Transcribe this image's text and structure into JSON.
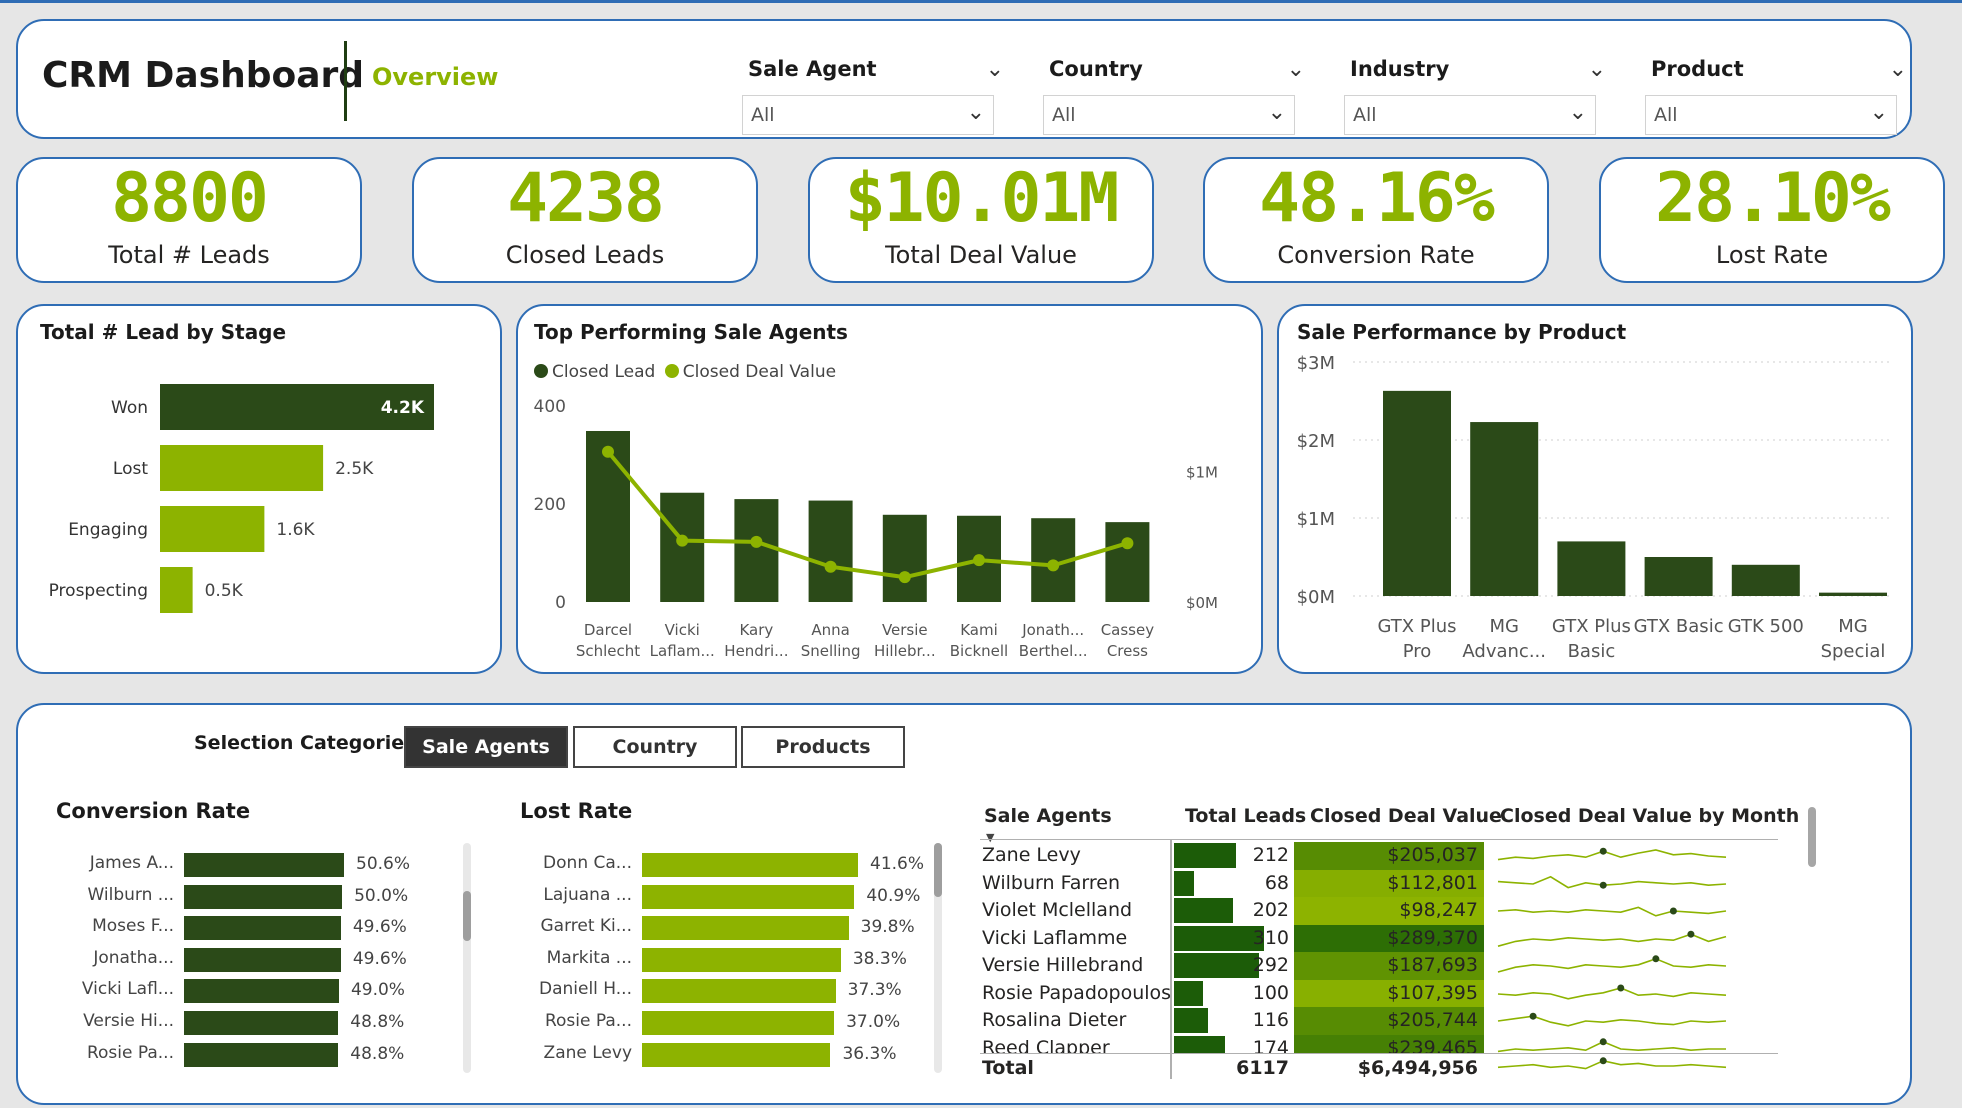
{
  "header": {
    "title": "CRM Dashboard",
    "subtitle": "Overview",
    "slicers": [
      {
        "label": "Sale Agent",
        "value": "All"
      },
      {
        "label": "Country",
        "value": "All"
      },
      {
        "label": "Industry",
        "value": "All"
      },
      {
        "label": "Product",
        "value": "All"
      }
    ]
  },
  "kpis": [
    {
      "value": "8800",
      "label": "Total # Leads"
    },
    {
      "value": "4238",
      "label": "Closed Leads"
    },
    {
      "value": "$10.01M",
      "label": "Total Deal Value"
    },
    {
      "value": "48.16%",
      "label": "Conversion Rate"
    },
    {
      "value": "28.10%",
      "label": "Lost Rate"
    }
  ],
  "colors": {
    "dark_green": "#2b4a18",
    "light_green": "#8db300",
    "accent_border": "#2f6db5"
  },
  "chart_data": [
    {
      "type": "bar",
      "orientation": "horizontal",
      "title": "Total # Lead by Stage",
      "categories": [
        "Won",
        "Lost",
        "Engaging",
        "Prospecting"
      ],
      "values": [
        4200,
        2500,
        1600,
        500
      ],
      "labels": [
        "4.2K",
        "2.5K",
        "1.6K",
        "0.5K"
      ]
    },
    {
      "type": "bar",
      "title": "Top Performing Sale Agents",
      "categories": [
        "Darcel Schlecht",
        "Vicki Laflam...",
        "Kary Hendri...",
        "Anna Snelling",
        "Versie Hillebr...",
        "Kami Bicknell",
        "Jonath... Berthel...",
        "Cassey Cress"
      ],
      "category_lines": [
        [
          "Darcel",
          "Schlecht"
        ],
        [
          "Vicki",
          "Laflam..."
        ],
        [
          "Kary",
          "Hendri..."
        ],
        [
          "Anna",
          "Snelling"
        ],
        [
          "Versie",
          "Hillebr..."
        ],
        [
          "Kami",
          "Bicknell"
        ],
        [
          "Jonath...",
          "Berthel..."
        ],
        [
          "Cassey",
          "Cress"
        ]
      ],
      "legend": [
        "Closed Lead",
        "Closed Deal Value"
      ],
      "series": [
        {
          "name": "Closed Lead",
          "values": [
            349,
            223,
            210,
            207,
            178,
            176,
            171,
            163
          ]
        },
        {
          "name": "Closed Deal Value",
          "values": [
            1150000,
            470000,
            460000,
            270000,
            190000,
            320000,
            280000,
            450000
          ]
        }
      ],
      "y_ticks": [
        "0",
        "200",
        "400"
      ],
      "y2_ticks": [
        "$0M",
        "$1M"
      ],
      "ylim": [
        0,
        400
      ],
      "y2lim": [
        0,
        1500000
      ]
    },
    {
      "type": "bar",
      "title": "Sale Performance by Product",
      "categories": [
        "GTX Plus Pro",
        "MG Advanc...",
        "GTX Plus Basic",
        "GTX Basic",
        "GTK 500",
        "MG Special"
      ],
      "category_lines": [
        [
          "GTX Plus",
          "Pro"
        ],
        [
          "MG",
          "Advanc..."
        ],
        [
          "GTX Plus",
          "Basic"
        ],
        [
          "GTX Basic"
        ],
        [
          "GTK 500"
        ],
        [
          "MG",
          "Special"
        ]
      ],
      "values": [
        2630000,
        2230000,
        700000,
        500000,
        400000,
        43000
      ],
      "y_ticks": [
        "$0M",
        "$1M",
        "$2M",
        "$3M"
      ],
      "ylim": [
        0,
        3000000
      ]
    },
    {
      "type": "bar",
      "orientation": "horizontal",
      "title": "Conversion Rate",
      "categories": [
        "James A...",
        "Wilburn ...",
        "Moses F...",
        "Jonatha...",
        "Vicki Lafl...",
        "Versie Hi...",
        "Rosie Pa..."
      ],
      "values": [
        50.6,
        50.0,
        49.6,
        49.6,
        49.0,
        48.8,
        48.8
      ],
      "labels": [
        "50.6%",
        "50.0%",
        "49.6%",
        "49.6%",
        "49.0%",
        "48.8%",
        "48.8%"
      ]
    },
    {
      "type": "bar",
      "orientation": "horizontal",
      "title": "Lost Rate",
      "categories": [
        "Donn Ca...",
        "Lajuana ...",
        "Garret Ki...",
        "Markita ...",
        "Daniell H...",
        "Rosie Pa...",
        "Zane Levy"
      ],
      "values": [
        41.6,
        40.9,
        39.8,
        38.3,
        37.3,
        37.0,
        36.3
      ],
      "labels": [
        "41.6%",
        "40.9%",
        "39.8%",
        "38.3%",
        "37.3%",
        "37.0%",
        "36.3%"
      ]
    },
    {
      "type": "table",
      "columns": [
        "Sale Agents",
        "Total Leads",
        "Closed Deal Value",
        "Closed Deal Value by Month"
      ],
      "rows": [
        {
          "name": "Zane Levy",
          "leads": 212,
          "leads_label": "212",
          "cdv": 205037,
          "cdv_label": "$205,037",
          "spark": [
            0.35,
            0.45,
            0.4,
            0.5,
            0.55,
            0.45,
            0.7,
            0.45,
            0.62,
            0.75,
            0.55,
            0.6,
            0.5,
            0.45
          ],
          "spark_dot": 6
        },
        {
          "name": "Wilburn Farren",
          "leads": 68,
          "leads_label": "68",
          "cdv": 112801,
          "cdv_label": "$112,801",
          "spark": [
            0.6,
            0.55,
            0.5,
            0.8,
            0.35,
            0.55,
            0.45,
            0.5,
            0.6,
            0.55,
            0.5,
            0.55,
            0.45,
            0.5
          ],
          "spark_dot": 6
        },
        {
          "name": "Violet Mclelland",
          "leads": 202,
          "leads_label": "202",
          "cdv": 98247,
          "cdv_label": "$98,247",
          "spark": [
            0.5,
            0.55,
            0.45,
            0.5,
            0.45,
            0.55,
            0.5,
            0.45,
            0.65,
            0.3,
            0.5,
            0.45,
            0.4,
            0.5
          ],
          "spark_dot": 10
        },
        {
          "name": "Vicki Laflamme",
          "leads": 310,
          "leads_label": "310",
          "cdv": 289370,
          "cdv_label": "$289,370",
          "spark": [
            0.2,
            0.4,
            0.5,
            0.45,
            0.55,
            0.5,
            0.45,
            0.5,
            0.4,
            0.5,
            0.45,
            0.7,
            0.4,
            0.6
          ],
          "spark_dot": 11
        },
        {
          "name": "Versie Hillebrand",
          "leads": 292,
          "leads_label": "292",
          "cdv": 187693,
          "cdv_label": "$187,693",
          "spark": [
            0.25,
            0.45,
            0.55,
            0.5,
            0.4,
            0.55,
            0.5,
            0.45,
            0.55,
            0.8,
            0.5,
            0.45,
            0.55,
            0.5
          ],
          "spark_dot": 9
        },
        {
          "name": "Rosie Papadopoulos",
          "leads": 100,
          "leads_label": "100",
          "cdv": 107395,
          "cdv_label": "$107,395",
          "spark": [
            0.5,
            0.45,
            0.55,
            0.5,
            0.3,
            0.45,
            0.55,
            0.75,
            0.45,
            0.5,
            0.4,
            0.55,
            0.5,
            0.45
          ],
          "spark_dot": 7
        },
        {
          "name": "Rosalina Dieter",
          "leads": 116,
          "leads_label": "116",
          "cdv": 205744,
          "cdv_label": "$205,744",
          "spark": [
            0.5,
            0.6,
            0.7,
            0.45,
            0.3,
            0.5,
            0.45,
            0.55,
            0.5,
            0.4,
            0.35,
            0.5,
            0.45,
            0.5
          ],
          "spark_dot": 2
        },
        {
          "name": "Reed Clapper",
          "leads": 174,
          "leads_label": "174",
          "cdv": 239465,
          "cdv_label": "$239,465",
          "spark": [
            0.4,
            0.5,
            0.45,
            0.5,
            0.55,
            0.45,
            0.8,
            0.5,
            0.45,
            0.5,
            0.55,
            0.45,
            0.5,
            0.5
          ],
          "spark_dot": 6
        }
      ],
      "total": {
        "label": "Total",
        "leads": "6117",
        "cdv": "$6,494,956"
      }
    }
  ],
  "bottom": {
    "selection_label": "Selection Categories",
    "tabs": [
      "Sale Agents",
      "Country",
      "Products"
    ],
    "active_tab": "Sale Agents"
  }
}
